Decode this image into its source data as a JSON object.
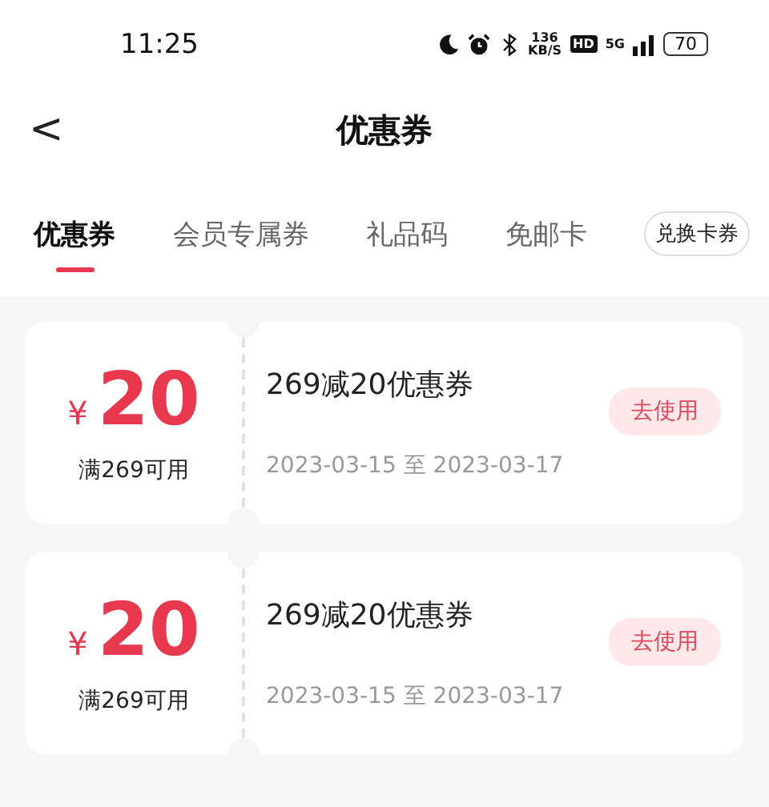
{
  "status_bar": {
    "time": "11:25",
    "net_speed_value": "136",
    "net_speed_unit": "KB/S",
    "hd": "HD",
    "network": "5G",
    "battery": "70"
  },
  "header": {
    "back": "<",
    "title": "优惠券"
  },
  "tabs": [
    {
      "label": "优惠券",
      "selected": true
    },
    {
      "label": "会员专属券",
      "selected": false
    },
    {
      "label": "礼品码",
      "selected": false
    },
    {
      "label": "免邮卡",
      "selected": false
    }
  ],
  "exchange_button": "兑换卡券",
  "coupons": [
    {
      "currency": "¥",
      "amount": "20",
      "condition": "满269可用",
      "title": "269减20优惠券",
      "start": "2023-03-15",
      "to": "至",
      "end": "2023-03-17",
      "action": "去使用"
    },
    {
      "currency": "¥",
      "amount": "20",
      "condition": "满269可用",
      "title": "269减20优惠券",
      "start": "2023-03-15",
      "to": "至",
      "end": "2023-03-17",
      "action": "去使用"
    }
  ]
}
